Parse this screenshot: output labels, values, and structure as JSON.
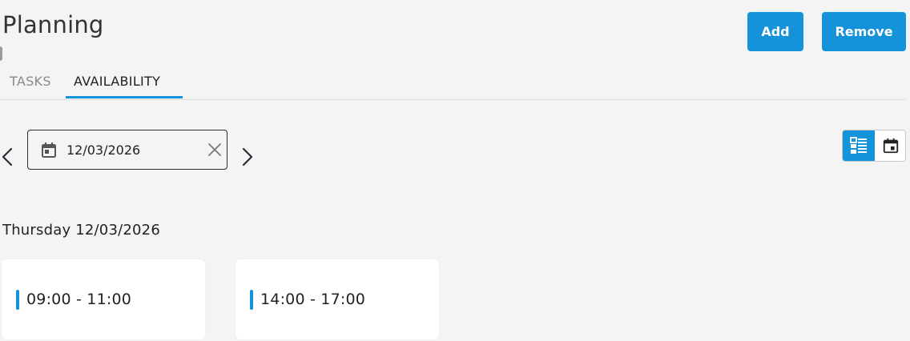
{
  "header": {
    "title": "Planning",
    "add_label": "Add",
    "remove_label": "Remove"
  },
  "tabs": [
    {
      "label": "TASKS",
      "active": false
    },
    {
      "label": "AVAILABILITY",
      "active": true
    }
  ],
  "date_picker": {
    "value": "12/03/2026",
    "icon": "calendar-icon",
    "clear_icon": "close-icon",
    "prev_icon": "chevron-left-icon",
    "next_icon": "chevron-right-icon"
  },
  "view_toggle": {
    "options": [
      "list-view-icon",
      "calendar-view-icon"
    ],
    "selected": "list-view-icon"
  },
  "day": {
    "heading": "Thursday 12/03/2026",
    "slots": [
      {
        "time": "09:00 - 11:00"
      },
      {
        "time": "14:00 - 17:00"
      }
    ]
  },
  "colors": {
    "accent": "#1593da",
    "background": "#f4f4f4",
    "muted_tab": "#8a8a8a"
  }
}
